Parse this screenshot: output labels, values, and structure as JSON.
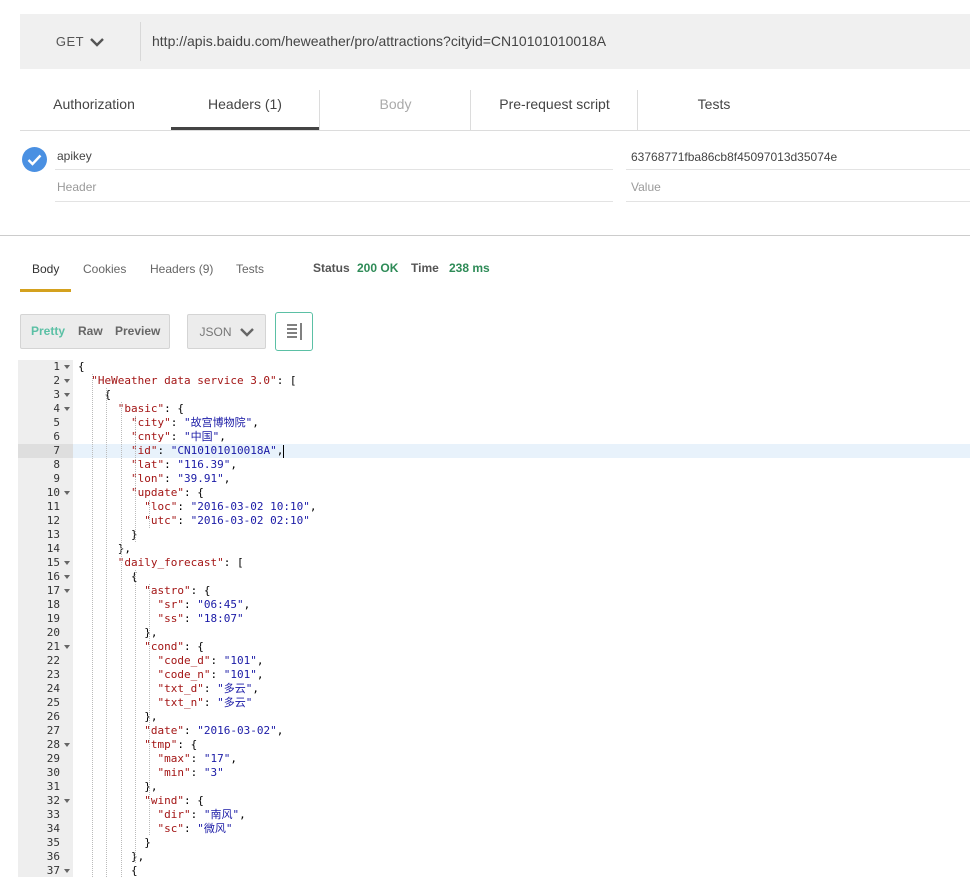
{
  "request": {
    "method": "GET",
    "url": "http://apis.baidu.com/heweather/pro/attractions?cityid=CN10101010018A"
  },
  "request_tabs": [
    "Authorization",
    "Headers (1)",
    "Body",
    "Pre-request script",
    "Tests"
  ],
  "headers": {
    "rows": [
      {
        "key": "apikey",
        "value": "63768771fba86cb8f45097013d35074e",
        "enabled": true
      }
    ],
    "key_placeholder": "Header",
    "value_placeholder": "Value"
  },
  "response": {
    "tabs": [
      "Body",
      "Cookies",
      "Headers (9)",
      "Tests"
    ],
    "status_label": "Status",
    "status_value": "200 OK",
    "time_label": "Time",
    "time_value": "238 ms",
    "view_modes": [
      "Pretty",
      "Raw",
      "Preview"
    ],
    "format": "JSON"
  },
  "editor": {
    "highlighted_line": 7,
    "lines": [
      {
        "n": "1",
        "fold": true,
        "t": "{"
      },
      {
        "n": "2",
        "fold": true,
        "t": "  \"HeWeather data service 3.0\": ["
      },
      {
        "n": "3",
        "fold": true,
        "t": "    {"
      },
      {
        "n": "4",
        "fold": true,
        "t": "      \"basic\": {"
      },
      {
        "n": "5",
        "fold": false,
        "t": "        \"city\": \"故宫博物院\","
      },
      {
        "n": "6",
        "fold": false,
        "t": "        \"cnty\": \"中国\","
      },
      {
        "n": "7",
        "fold": false,
        "t": "        \"id\": \"CN10101010018A\","
      },
      {
        "n": "8",
        "fold": false,
        "t": "        \"lat\": \"116.39\","
      },
      {
        "n": "9",
        "fold": false,
        "t": "        \"lon\": \"39.91\","
      },
      {
        "n": "10",
        "fold": true,
        "t": "        \"update\": {"
      },
      {
        "n": "11",
        "fold": false,
        "t": "          \"loc\": \"2016-03-02 10:10\","
      },
      {
        "n": "12",
        "fold": false,
        "t": "          \"utc\": \"2016-03-02 02:10\""
      },
      {
        "n": "13",
        "fold": false,
        "t": "        }"
      },
      {
        "n": "14",
        "fold": false,
        "t": "      },"
      },
      {
        "n": "15",
        "fold": true,
        "t": "      \"daily_forecast\": ["
      },
      {
        "n": "16",
        "fold": true,
        "t": "        {"
      },
      {
        "n": "17",
        "fold": true,
        "t": "          \"astro\": {"
      },
      {
        "n": "18",
        "fold": false,
        "t": "            \"sr\": \"06:45\","
      },
      {
        "n": "19",
        "fold": false,
        "t": "            \"ss\": \"18:07\""
      },
      {
        "n": "20",
        "fold": false,
        "t": "          },"
      },
      {
        "n": "21",
        "fold": true,
        "t": "          \"cond\": {"
      },
      {
        "n": "22",
        "fold": false,
        "t": "            \"code_d\": \"101\","
      },
      {
        "n": "23",
        "fold": false,
        "t": "            \"code_n\": \"101\","
      },
      {
        "n": "24",
        "fold": false,
        "t": "            \"txt_d\": \"多云\","
      },
      {
        "n": "25",
        "fold": false,
        "t": "            \"txt_n\": \"多云\""
      },
      {
        "n": "26",
        "fold": false,
        "t": "          },"
      },
      {
        "n": "27",
        "fold": false,
        "t": "          \"date\": \"2016-03-02\","
      },
      {
        "n": "28",
        "fold": true,
        "t": "          \"tmp\": {"
      },
      {
        "n": "29",
        "fold": false,
        "t": "            \"max\": \"17\","
      },
      {
        "n": "30",
        "fold": false,
        "t": "            \"min\": \"3\""
      },
      {
        "n": "31",
        "fold": false,
        "t": "          },"
      },
      {
        "n": "32",
        "fold": true,
        "t": "          \"wind\": {"
      },
      {
        "n": "33",
        "fold": false,
        "t": "            \"dir\": \"南风\","
      },
      {
        "n": "34",
        "fold": false,
        "t": "            \"sc\": \"微风\""
      },
      {
        "n": "35",
        "fold": false,
        "t": "          }"
      },
      {
        "n": "36",
        "fold": false,
        "t": "        },"
      },
      {
        "n": "37",
        "fold": true,
        "t": "        {"
      }
    ]
  }
}
